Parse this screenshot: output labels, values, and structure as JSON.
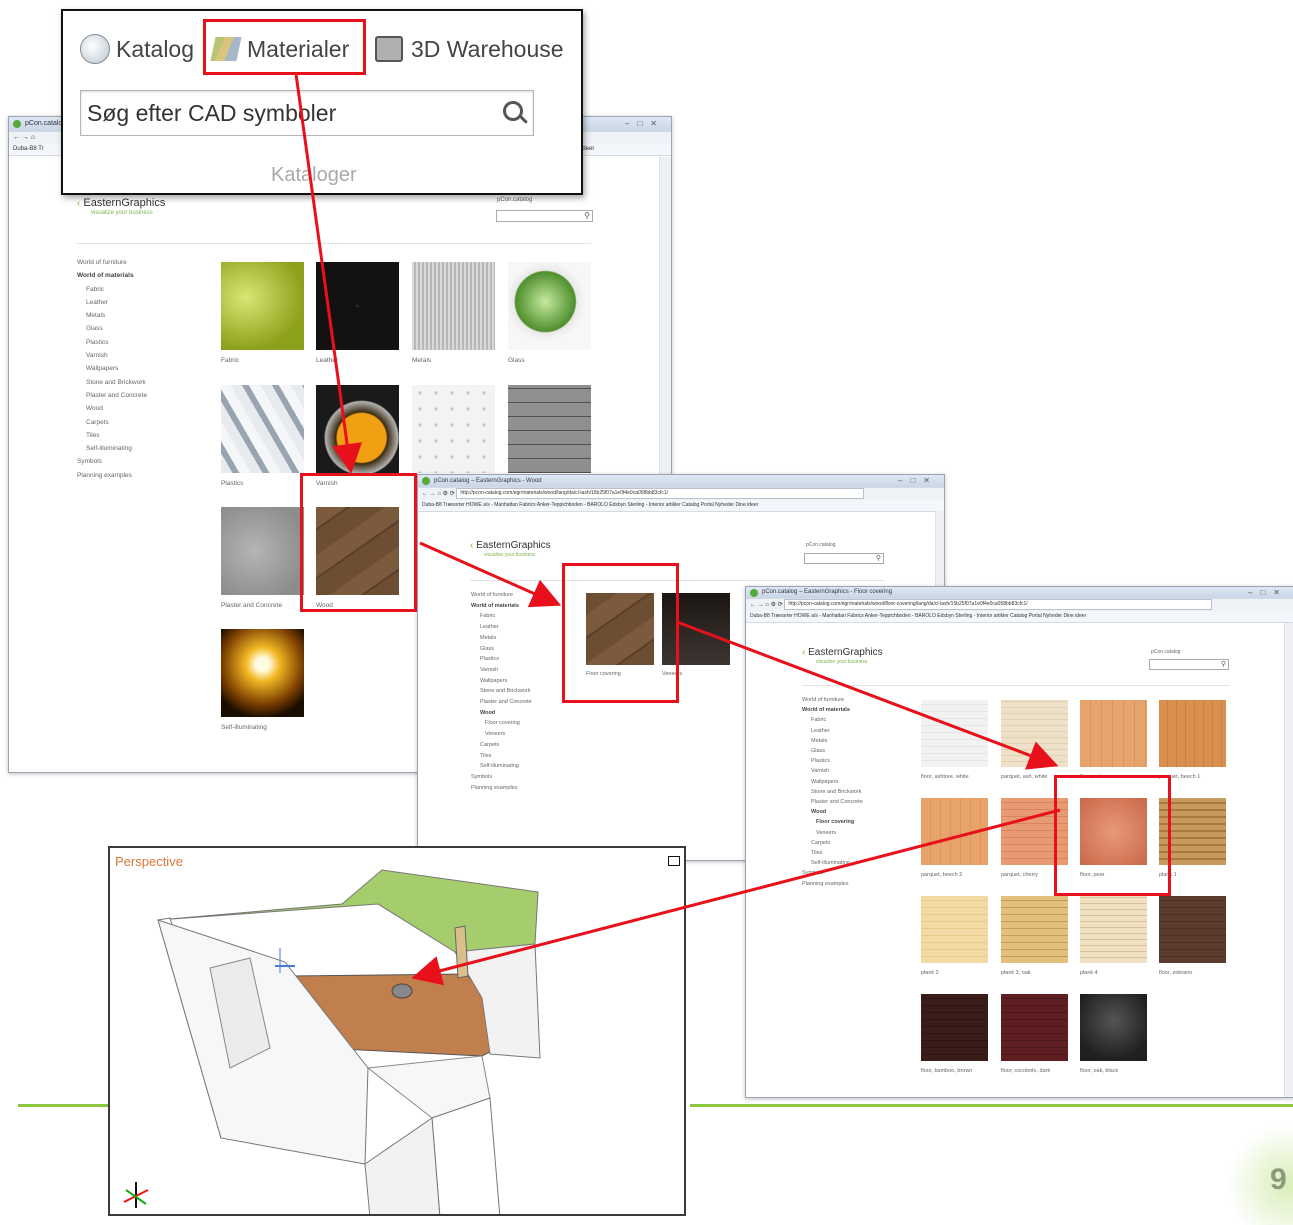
{
  "colors": {
    "accent_red": "#e8111b",
    "brand_green": "#7ab648",
    "slide_line": "#8cc63f"
  },
  "slide": {
    "page_number": "9"
  },
  "callout": {
    "tabs": [
      {
        "label": "Katalog",
        "icon": "globe-search-icon"
      },
      {
        "label": "Materialer",
        "icon": "materials-icon"
      },
      {
        "label": "3D Warehouse",
        "icon": "warehouse-icon"
      }
    ],
    "search_placeholder": "Søg efter CAD symboler",
    "section_label": "Kataloger"
  },
  "browser1": {
    "title": "pCon.catalog",
    "bookmark": "Duba-B8 Tr",
    "bookmark_right": "ideer",
    "logo": "EasternGraphics",
    "tagline": "visualize your business",
    "search_label": "pCon.catalog",
    "sidebar": [
      {
        "label": "World of furniture",
        "level": 0,
        "bold": false
      },
      {
        "label": "World of materials",
        "level": 0,
        "bold": true
      },
      {
        "label": "Fabric",
        "level": 1,
        "bold": false
      },
      {
        "label": "Leather",
        "level": 1,
        "bold": false
      },
      {
        "label": "Metals",
        "level": 1,
        "bold": false
      },
      {
        "label": "Glass",
        "level": 1,
        "bold": false
      },
      {
        "label": "Plastics",
        "level": 1,
        "bold": false
      },
      {
        "label": "Varnish",
        "level": 1,
        "bold": false
      },
      {
        "label": "Wallpapers",
        "level": 1,
        "bold": false
      },
      {
        "label": "Stone and Brickwork",
        "level": 1,
        "bold": false
      },
      {
        "label": "Plaster and Concrete",
        "level": 1,
        "bold": false
      },
      {
        "label": "Wood",
        "level": 1,
        "bold": false
      },
      {
        "label": "Carpets",
        "level": 1,
        "bold": false
      },
      {
        "label": "Tiles",
        "level": 1,
        "bold": false
      },
      {
        "label": "Self-illuminating",
        "level": 1,
        "bold": false
      },
      {
        "label": "Symbols",
        "level": 0,
        "bold": false
      },
      {
        "label": "Planning examples",
        "level": 0,
        "bold": false
      }
    ],
    "tiles": [
      "Fabric",
      "Leather",
      "Metals",
      "Glass",
      "Plastics",
      "Varnish",
      "",
      "",
      "Plaster and Concrete",
      "Wood",
      "Self-illuminating"
    ]
  },
  "browser2": {
    "title": "pCon.catalog – EasternGraphics - Wood",
    "url": "http://pcon-catalog.com/egr/materials/wood/lang/da/cl-lash/15b25f07a1e0f4e0ca058bb83cfc1/",
    "bookmarks": "Duba-B8 Træsorter   HOWE a/s - Manhattan Fabrics   Anker-Teppichboden - BAROLO   Edsbyn   Sterling - Interior artikler   Catalog Portal   Nyheder   Dine ideer",
    "logo": "EasternGraphics",
    "tagline": "visualize your business",
    "search_label": "pCon.catalog",
    "sidebar": [
      {
        "label": "World of furniture",
        "level": 0,
        "bold": false
      },
      {
        "label": "World of materials",
        "level": 0,
        "bold": true
      },
      {
        "label": "Fabric",
        "level": 1,
        "bold": false
      },
      {
        "label": "Leather",
        "level": 1,
        "bold": false
      },
      {
        "label": "Metals",
        "level": 1,
        "bold": false
      },
      {
        "label": "Glass",
        "level": 1,
        "bold": false
      },
      {
        "label": "Plastics",
        "level": 1,
        "bold": false
      },
      {
        "label": "Varnish",
        "level": 1,
        "bold": false
      },
      {
        "label": "Wallpapers",
        "level": 1,
        "bold": false
      },
      {
        "label": "Stone and Brickwork",
        "level": 1,
        "bold": false
      },
      {
        "label": "Plaster and Concrete",
        "level": 1,
        "bold": false
      },
      {
        "label": "Wood",
        "level": 1,
        "bold": true
      },
      {
        "label": "Floor covering",
        "level": 2,
        "bold": false
      },
      {
        "label": "Veneers",
        "level": 2,
        "bold": false
      },
      {
        "label": "Carpets",
        "level": 1,
        "bold": false
      },
      {
        "label": "Tiles",
        "level": 1,
        "bold": false
      },
      {
        "label": "Self-illuminating",
        "level": 1,
        "bold": false
      },
      {
        "label": "Symbols",
        "level": 0,
        "bold": false
      },
      {
        "label": "Planning examples",
        "level": 0,
        "bold": false
      }
    ],
    "tiles": [
      "Floor covering",
      "Veneers"
    ]
  },
  "browser3": {
    "title": "pCon.catalog – EasternGraphics - Floor covering",
    "url": "http://pcon-catalog.com/egr/materials/wood/floor-covering/lang/da/cl-lash/15b25f07a1e0f4e0ca058bb83cfc1/",
    "bookmarks": "Duba-B8 Træsorter   HOWE a/s - Manhattan Fabrics   Anker-Teppichboden - BAROLO   Edsbyn   Sterling - Interior artikler   Catalog Portal   Nyheder   Dine ideer",
    "logo": "EasternGraphics",
    "tagline": "visualize your business",
    "search_label": "pCon.catalog",
    "sidebar": [
      {
        "label": "World of furniture",
        "level": 0,
        "bold": false
      },
      {
        "label": "World of materials",
        "level": 0,
        "bold": true
      },
      {
        "label": "Fabric",
        "level": 1,
        "bold": false
      },
      {
        "label": "Leather",
        "level": 1,
        "bold": false
      },
      {
        "label": "Metals",
        "level": 1,
        "bold": false
      },
      {
        "label": "Glass",
        "level": 1,
        "bold": false
      },
      {
        "label": "Plastics",
        "level": 1,
        "bold": false
      },
      {
        "label": "Varnish",
        "level": 1,
        "bold": false
      },
      {
        "label": "Wallpapers",
        "level": 1,
        "bold": false
      },
      {
        "label": "Stone and Brickwork",
        "level": 1,
        "bold": false
      },
      {
        "label": "Plaster and Concrete",
        "level": 1,
        "bold": false
      },
      {
        "label": "Wood",
        "level": 1,
        "bold": true
      },
      {
        "label": "Floor covering",
        "level": 2,
        "bold": true
      },
      {
        "label": "Veneers",
        "level": 2,
        "bold": false
      },
      {
        "label": "Carpets",
        "level": 1,
        "bold": false
      },
      {
        "label": "Tiles",
        "level": 1,
        "bold": false
      },
      {
        "label": "Self-illuminating",
        "level": 1,
        "bold": false
      },
      {
        "label": "Symbols",
        "level": 0,
        "bold": false
      },
      {
        "label": "Planning examples",
        "level": 0,
        "bold": false
      }
    ],
    "tiles": [
      "floor, ashtree, white",
      "parquet, ash, white",
      "floor, oak",
      "parquet, beech 1",
      "parquet, beech 2",
      "parquet, cherry",
      "floor, pear",
      "plank 1",
      "plank 2",
      "plank 3, oak",
      "plank 4",
      "floor, zebrano",
      "floor, bamboo, brown",
      "floor, cocobolo, dark",
      "floor, oak, black"
    ]
  },
  "viewport": {
    "title": "Perspective"
  }
}
